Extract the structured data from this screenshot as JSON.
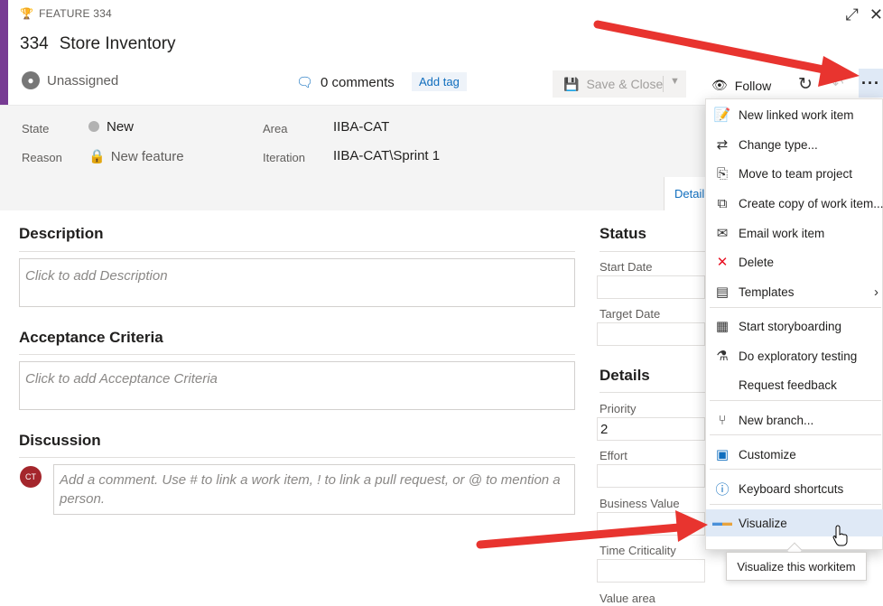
{
  "header": {
    "type_label": "FEATURE 334",
    "id": "334",
    "title": "Store Inventory",
    "assignee": "Unassigned",
    "comments": "0 comments",
    "add_tag": "Add tag",
    "save_close": "Save & Close",
    "follow": "Follow",
    "accent_color": "#773b93"
  },
  "meta": {
    "state_label": "State",
    "state_value": "New",
    "reason_label": "Reason",
    "reason_value": "New feature",
    "area_label": "Area",
    "area_value": "IIBA-CAT",
    "iteration_label": "Iteration",
    "iteration_value": "IIBA-CAT\\Sprint 1",
    "details_tab": "Detail"
  },
  "main": {
    "description_title": "Description",
    "description_placeholder": "Click to add Description",
    "acceptance_title": "Acceptance Criteria",
    "acceptance_placeholder": "Click to add Acceptance Criteria",
    "discussion_title": "Discussion",
    "comment_placeholder": "Add a comment. Use # to link a work item, ! to link a pull request, or @ to mention a person.",
    "avatar_initials": "CT"
  },
  "right_panel": {
    "status_title": "Status",
    "start_date_label": "Start Date",
    "target_date_label": "Target Date",
    "details_title": "Details",
    "priority_label": "Priority",
    "priority_value": "2",
    "effort_label": "Effort",
    "business_value_label": "Business Value",
    "time_criticality_label": "Time Criticality",
    "value_area_label": "Value area"
  },
  "menu": {
    "items": [
      {
        "label": "New linked work item",
        "icon": "new-linked-icon"
      },
      {
        "label": "Change type...",
        "icon": "change-type-icon"
      },
      {
        "label": "Move to team project",
        "icon": "move-icon"
      },
      {
        "label": "Create copy of work item...",
        "icon": "copy-icon"
      },
      {
        "label": "Email work item",
        "icon": "email-icon"
      },
      {
        "label": "Delete",
        "icon": "delete-icon"
      },
      {
        "label": "Templates",
        "icon": "templates-icon"
      },
      {
        "label": "Start storyboarding",
        "icon": "storyboard-icon"
      },
      {
        "label": "Do exploratory testing",
        "icon": "exploratory-icon"
      },
      {
        "label": "Request feedback",
        "icon": ""
      },
      {
        "label": "New branch...",
        "icon": "branch-icon"
      },
      {
        "label": "Customize",
        "icon": "customize-icon"
      },
      {
        "label": "Keyboard shortcuts",
        "icon": "info-icon"
      },
      {
        "label": "Visualize",
        "icon": "visualize-icon"
      }
    ],
    "tooltip": "Visualize this workitem"
  },
  "colors": {
    "arrow": "#e8342f",
    "link": "#106ebe",
    "active_item": "#dfe9f6"
  }
}
